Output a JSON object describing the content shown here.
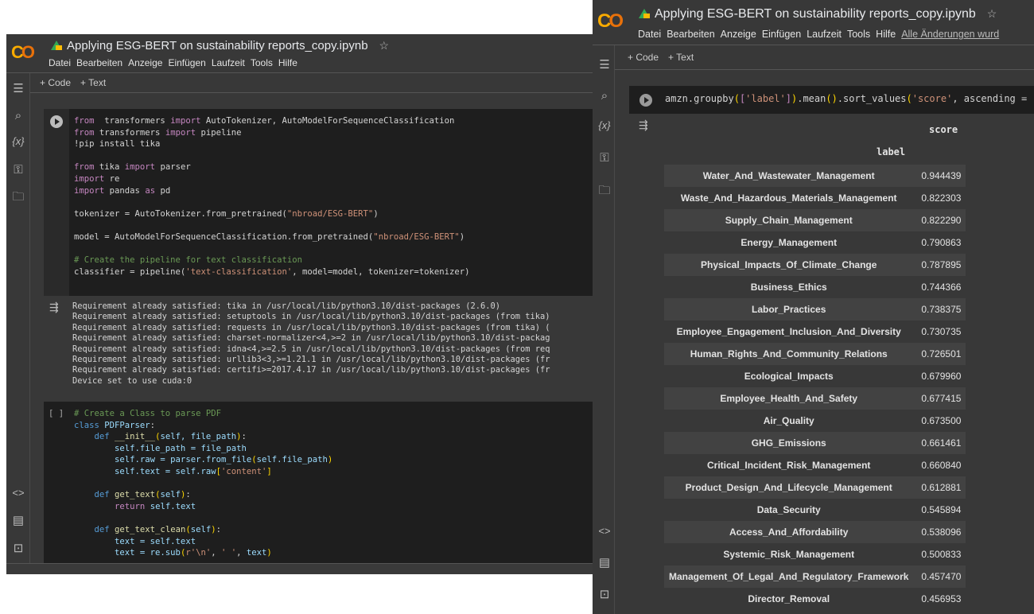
{
  "left": {
    "title": "Applying ESG-BERT on sustainability reports_copy.ipynb",
    "menu": [
      "Datei",
      "Bearbeiten",
      "Anzeige",
      "Einfügen",
      "Laufzeit",
      "Tools",
      "Hilfe"
    ],
    "toolbar": {
      "code": "+ Code",
      "text": "+ Text"
    },
    "cell1": [
      [
        [
          "kw",
          "from"
        ],
        [
          "",
          "  transformers "
        ],
        [
          "kw",
          "import"
        ],
        [
          "",
          " AutoTokenizer, AutoModelForSequenceClassification"
        ]
      ],
      [
        [
          "kw",
          "from"
        ],
        [
          "",
          " transformers "
        ],
        [
          "kw",
          "import"
        ],
        [
          "",
          " pipeline"
        ]
      ],
      [
        [
          "",
          "!pip install tika"
        ]
      ],
      [],
      [
        [
          "kw",
          "from"
        ],
        [
          "",
          " tika "
        ],
        [
          "kw",
          "import"
        ],
        [
          "",
          " parser"
        ]
      ],
      [
        [
          "kw",
          "import"
        ],
        [
          "",
          " re"
        ]
      ],
      [
        [
          "kw",
          "import"
        ],
        [
          "",
          " pandas "
        ],
        [
          "kw",
          "as"
        ],
        [
          "",
          " pd"
        ]
      ],
      [],
      [
        [
          "",
          "tokenizer = AutoTokenizer.from_pretrained("
        ],
        [
          "st",
          "\"nbroad/ESG-BERT\""
        ],
        [
          "",
          ")"
        ]
      ],
      [],
      [
        [
          "",
          "model = AutoModelForSequenceClassification.from_pretrained("
        ],
        [
          "st",
          "\"nbroad/ESG-BERT\""
        ],
        [
          "",
          ")"
        ]
      ],
      [],
      [
        [
          "cm",
          "# Create the pipeline for text classification"
        ]
      ],
      [
        [
          "",
          "classifier = pipeline("
        ],
        [
          "st",
          "'text-classification'"
        ],
        [
          "",
          ", model=model, tokenizer=tokenizer)"
        ]
      ]
    ],
    "output1": [
      "Requirement already satisfied: tika in /usr/local/lib/python3.10/dist-packages (2.6.0)",
      "Requirement already satisfied: setuptools in /usr/local/lib/python3.10/dist-packages (from tika)",
      "Requirement already satisfied: requests in /usr/local/lib/python3.10/dist-packages (from tika) (",
      "Requirement already satisfied: charset-normalizer<4,>=2 in /usr/local/lib/python3.10/dist-packag",
      "Requirement already satisfied: idna<4,>=2.5 in /usr/local/lib/python3.10/dist-packages (from req",
      "Requirement already satisfied: urllib3<3,>=1.21.1 in /usr/local/lib/python3.10/dist-packages (fr",
      "Requirement already satisfied: certifi>=2017.4.17 in /usr/local/lib/python3.10/dist-packages (fr",
      "Device set to use cuda:0"
    ],
    "cell2_bracket": "[ ]",
    "cell2": [
      [
        [
          "cm",
          "# Create a Class to parse PDF"
        ]
      ],
      [
        [
          "bl",
          "class"
        ],
        [
          "vr",
          " PDFParser"
        ],
        [
          "",
          ":"
        ]
      ],
      [
        [
          "",
          "    "
        ],
        [
          "bl",
          "def"
        ],
        [
          "fn",
          " __init__"
        ],
        [
          "br",
          "("
        ],
        [
          "vr",
          "self, file_path"
        ],
        [
          "br",
          ")"
        ],
        [
          "",
          ":"
        ]
      ],
      [
        [
          "vr",
          "        self.file_path = file_path"
        ]
      ],
      [
        [
          "vr",
          "        self.raw = parser.from_file"
        ],
        [
          "br",
          "("
        ],
        [
          "vr",
          "self.file_path"
        ],
        [
          "br",
          ")"
        ]
      ],
      [
        [
          "vr",
          "        self.text = self.raw"
        ],
        [
          "br",
          "["
        ],
        [
          "st",
          "'content'"
        ],
        [
          "br",
          "]"
        ]
      ],
      [],
      [
        [
          "",
          "    "
        ],
        [
          "bl",
          "def"
        ],
        [
          "fn",
          " get_text"
        ],
        [
          "br",
          "("
        ],
        [
          "vr",
          "self"
        ],
        [
          "br",
          ")"
        ],
        [
          "",
          ":"
        ]
      ],
      [
        [
          "",
          "        "
        ],
        [
          "kw",
          "return"
        ],
        [
          "vr",
          " self.text"
        ]
      ],
      [],
      [
        [
          "",
          "    "
        ],
        [
          "bl",
          "def"
        ],
        [
          "fn",
          " get_text_clean"
        ],
        [
          "br",
          "("
        ],
        [
          "vr",
          "self"
        ],
        [
          "br",
          ")"
        ],
        [
          "",
          ":"
        ]
      ],
      [
        [
          "vr",
          "        text = self.text"
        ]
      ],
      [
        [
          "vr",
          "        text = re.sub"
        ],
        [
          "br",
          "("
        ],
        [
          "st",
          "r'\\n'"
        ],
        [
          "",
          ", "
        ],
        [
          "st",
          "' '"
        ],
        [
          "",
          ", "
        ],
        [
          "vr",
          "text"
        ],
        [
          "br",
          ")"
        ]
      ]
    ]
  },
  "right": {
    "title": "Applying ESG-BERT on sustainability reports_copy.ipynb",
    "menu": [
      "Datei",
      "Bearbeiten",
      "Anzeige",
      "Einfügen",
      "Laufzeit",
      "Tools",
      "Hilfe"
    ],
    "saved": "Alle Änderungen wurd",
    "toolbar": {
      "code": "+ Code",
      "text": "+ Text"
    },
    "cell": [
      [
        [
          "",
          "amzn.groupby"
        ],
        [
          "br",
          "("
        ],
        [
          "kw",
          "["
        ],
        [
          "st",
          "'label'"
        ],
        [
          "kw",
          "]"
        ],
        [
          "br",
          ")"
        ],
        [
          "",
          ".mean"
        ],
        [
          "br",
          "()"
        ],
        [
          "",
          ".sort_values"
        ],
        [
          "br",
          "("
        ],
        [
          "st",
          "'score'"
        ],
        [
          "",
          ", ascending = "
        ]
      ]
    ],
    "table": {
      "column": "score",
      "index_name": "label",
      "rows": [
        [
          "Water_And_Wastewater_Management",
          "0.944439"
        ],
        [
          "Waste_And_Hazardous_Materials_Management",
          "0.822303"
        ],
        [
          "Supply_Chain_Management",
          "0.822290"
        ],
        [
          "Energy_Management",
          "0.790863"
        ],
        [
          "Physical_Impacts_Of_Climate_Change",
          "0.787895"
        ],
        [
          "Business_Ethics",
          "0.744366"
        ],
        [
          "Labor_Practices",
          "0.738375"
        ],
        [
          "Employee_Engagement_Inclusion_And_Diversity",
          "0.730735"
        ],
        [
          "Human_Rights_And_Community_Relations",
          "0.726501"
        ],
        [
          "Ecological_Impacts",
          "0.679960"
        ],
        [
          "Employee_Health_And_Safety",
          "0.677415"
        ],
        [
          "Air_Quality",
          "0.673500"
        ],
        [
          "GHG_Emissions",
          "0.661461"
        ],
        [
          "Critical_Incident_Risk_Management",
          "0.660840"
        ],
        [
          "Product_Design_And_Lifecycle_Management",
          "0.612881"
        ],
        [
          "Data_Security",
          "0.545894"
        ],
        [
          "Access_And_Affordability",
          "0.538096"
        ],
        [
          "Systemic_Risk_Management",
          "0.500833"
        ],
        [
          "Management_Of_Legal_And_Regulatory_Framework",
          "0.457470"
        ],
        [
          "Director_Removal",
          "0.456953"
        ]
      ]
    }
  }
}
